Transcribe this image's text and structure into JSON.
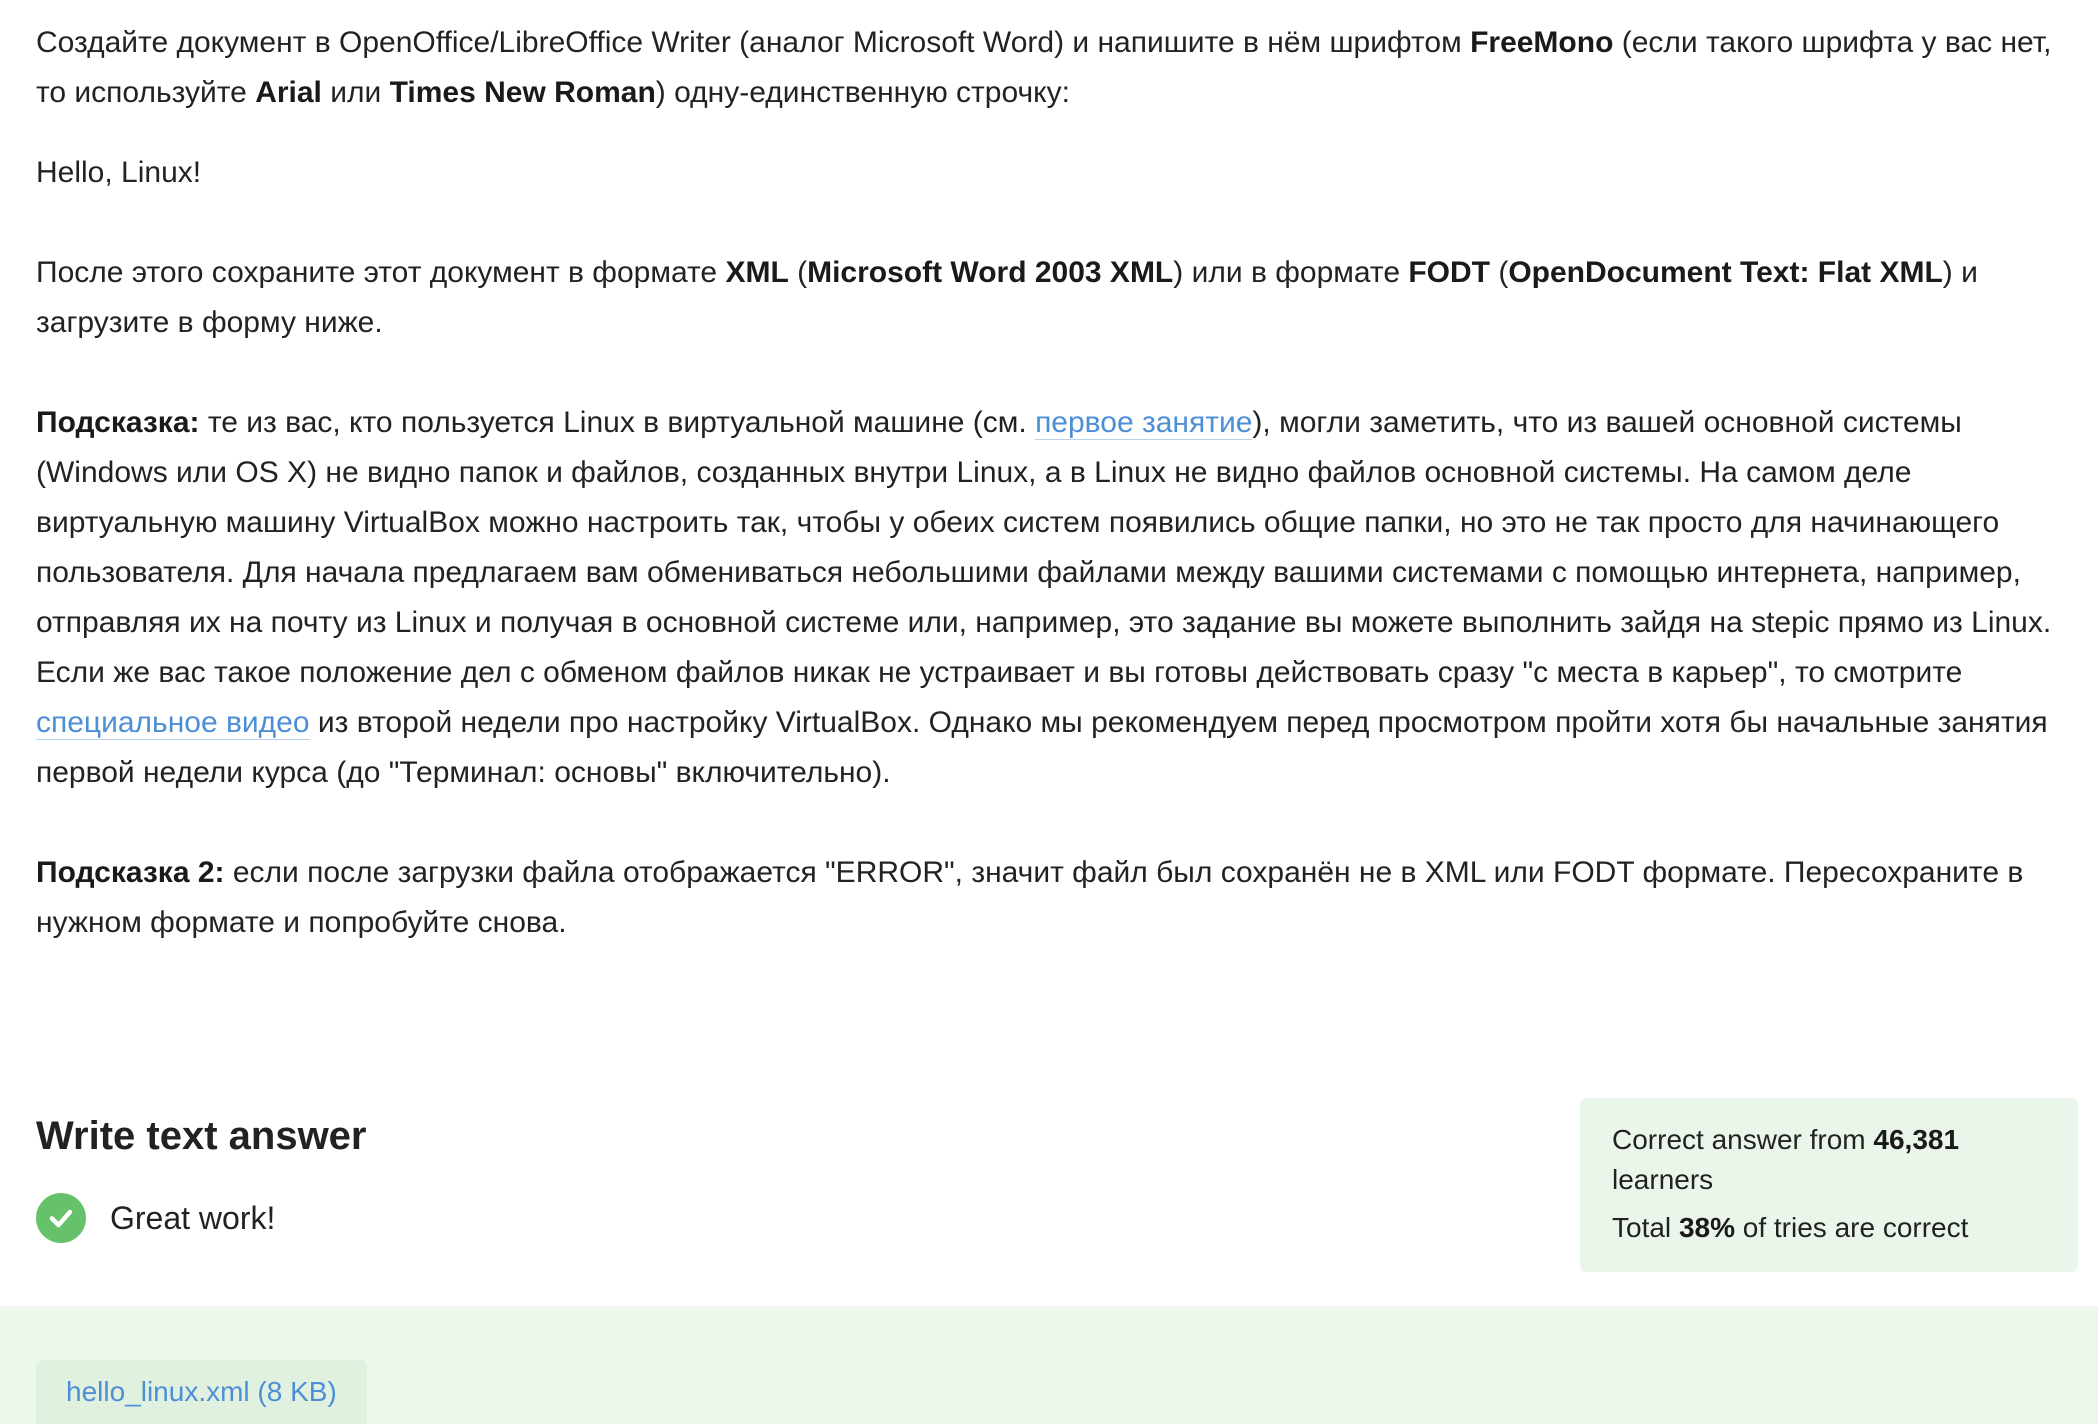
{
  "task": {
    "p1": {
      "t1": "Создайте документ в OpenOffice/LibreOffice Writer (аналог Microsoft Word) и напишите в нём шрифтом ",
      "b1": "FreeMono",
      "t2": " (если такого шрифта у вас нет, то используйте ",
      "b2": "Arial",
      "t3": " или ",
      "b3": "Times New Roman",
      "t4": ") одну-единственную строчку:"
    },
    "p2": "Hello, Linux!",
    "p3": {
      "t1": "После этого сохраните этот документ в формате ",
      "b1": "XML",
      "t2": " (",
      "b2": "Microsoft Word 2003 XML",
      "t3": ") или в формате ",
      "b3": "FODT",
      "t4": " (",
      "b4": "OpenDocument Text: Flat XML",
      "t5": ") и загрузите в форму ниже."
    },
    "hint1": {
      "label": "Подсказка:",
      "t1": " те из вас, кто пользуется Linux в виртуальной машине (см. ",
      "link1": "первое занятие",
      "t2": "), могли заметить, что из вашей основной системы (Windows или OS X) не видно папок и файлов, созданных внутри Linux, а в Linux не видно файлов основной системы. На самом деле виртуальную машину VirtualBox можно настроить так, чтобы у обеих систем появились общие папки, но это не так просто для начинающего пользователя. Для начала предлагаем вам обмениваться небольшими файлами между вашими системами с помощью интернета, например, отправляя их на почту из Linux и получая в основной системе или, например, это задание вы можете выполнить зайдя на stepic прямо из Linux."
    },
    "hint1b": {
      "t1": "Если же вас такое положение дел с обменом файлов никак не устраивает и вы готовы действовать сразу \"с места в карьер\", то смотрите ",
      "link2": "специальное видео",
      "t2": " из второй недели про настройку VirtualBox. Однако мы рекомендуем перед просмотром пройти хотя бы начальные занятия первой недели курса (до \"Терминал: основы\" включительно)."
    },
    "hint2": {
      "label": "Подсказка 2:",
      "t1": " если после загрузки файла отображается \"ERROR\", значит файл был сохранён не в XML или FODT формате. Пересохраните в нужном формате и попробуйте снова."
    }
  },
  "answer": {
    "title": "Write text answer",
    "status_icon": "check-circle-icon",
    "status_text": "Great work!"
  },
  "stats": {
    "line1_pre": "Correct answer from ",
    "learners_count": "46,381",
    "line1_post": " learners",
    "line2_pre": "Total ",
    "percent": "38%",
    "line2_post": " of tries are correct"
  },
  "attachment": {
    "file_label": "hello_linux.xml (8 KB)"
  },
  "colors": {
    "link": "#4d8fd6",
    "success_green": "#66c26a",
    "stats_bg": "#ebf6ea",
    "panel_bg": "#edf7ec",
    "chip_bg": "#e1f1e0"
  }
}
